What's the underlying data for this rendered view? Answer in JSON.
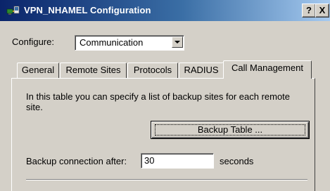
{
  "window": {
    "title": "VPN_NHAMEL Configuration",
    "help_label": "?",
    "close_label": "X"
  },
  "configure": {
    "label": "Configure:",
    "selected": "Communication"
  },
  "tabs": [
    {
      "label": "General"
    },
    {
      "label": "Remote Sites"
    },
    {
      "label": "Protocols"
    },
    {
      "label": "RADIUS"
    },
    {
      "label": "Call Management",
      "active": true
    }
  ],
  "panel": {
    "description": "In this table you can specify a list of backup sites for each remote site.",
    "backup_table_button": "Backup Table ...",
    "backup_after_label": "Backup connection after:",
    "backup_after_value": "30",
    "backup_after_unit": "seconds"
  }
}
